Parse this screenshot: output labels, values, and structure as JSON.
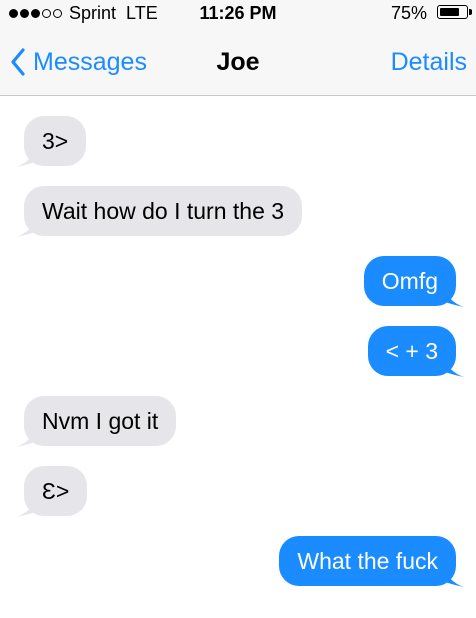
{
  "status_bar": {
    "signal_dots": 5,
    "signal_filled": 3,
    "carrier": "Sprint  LTE",
    "time": "11:26 PM",
    "battery_percent": "75%",
    "battery_level": 0.75
  },
  "nav": {
    "back_label": "Messages",
    "title": "Joe",
    "details_label": "Details",
    "back_icon": "chevron-left-icon"
  },
  "colors": {
    "accent": "#1a8cff",
    "incoming_bubble": "#e5e5ea",
    "outgoing_bubble": "#1a8cff"
  },
  "messages": [
    {
      "direction": "incoming",
      "text": "3>"
    },
    {
      "direction": "incoming",
      "text": "Wait how do I turn the 3"
    },
    {
      "direction": "outgoing",
      "text": "Omfg"
    },
    {
      "direction": "outgoing",
      "text": "< + 3"
    },
    {
      "direction": "incoming",
      "text": "Nvm I got it"
    },
    {
      "direction": "incoming",
      "text": "Ɛ>"
    },
    {
      "direction": "outgoing",
      "text": "What the fuck"
    }
  ]
}
